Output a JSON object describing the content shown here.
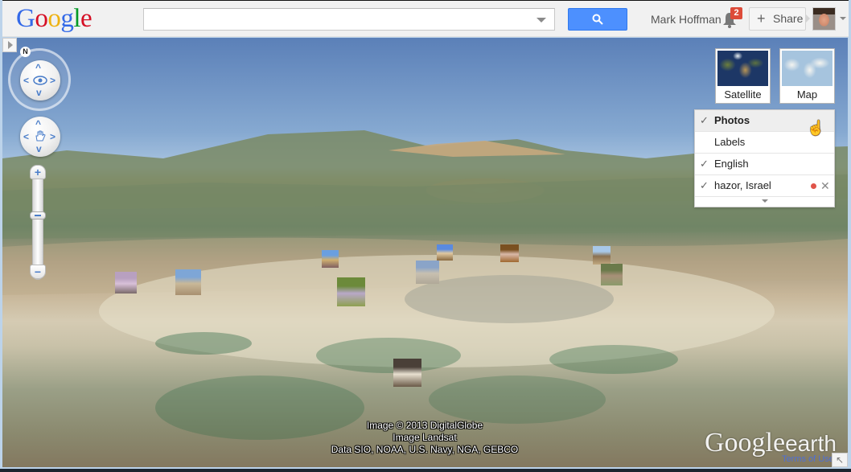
{
  "header": {
    "logo_letters": [
      "G",
      "o",
      "o",
      "g",
      "l",
      "e"
    ],
    "search": {
      "value": "",
      "placeholder": ""
    },
    "search_button_icon": "search-icon",
    "user_name": "Mark Hoffman",
    "notification_count": "2",
    "share_label": "Share",
    "share_icon": "+",
    "avatar_icon": "user-avatar"
  },
  "navigation": {
    "north_label": "N",
    "look_arrows": [
      "^",
      "<",
      ">",
      "v"
    ],
    "move_arrows": [
      "^",
      "<",
      ">",
      "v"
    ],
    "zoom_in": "+",
    "zoom_out": "−",
    "zoom_level": 0.4
  },
  "map_types": [
    {
      "label": "Satellite"
    },
    {
      "label": "Map"
    }
  ],
  "layers": [
    {
      "label": "Photos",
      "checked": true,
      "check": "✓",
      "bold": true,
      "hover": true
    },
    {
      "label": "Labels",
      "checked": false,
      "check": "",
      "bold": false
    },
    {
      "label": "English",
      "checked": true,
      "check": "✓",
      "bold": false
    },
    {
      "label": "hazor, Israel",
      "checked": true,
      "check": "✓",
      "bold": false,
      "dot_color": "#e0544a",
      "remove": "✕"
    }
  ],
  "photos": [
    {
      "colors": [
        "#b8a0c0",
        "#d8c0d8",
        "#7a6a6a"
      ]
    },
    {
      "colors": [
        "#7ea6d6",
        "#c9b898",
        "#a89070"
      ]
    },
    {
      "colors": [
        "#6a9fe0",
        "#d0b070",
        "#806060"
      ]
    },
    {
      "colors": [
        "#6c8a3a",
        "#b8a8c8",
        "#8ea050"
      ]
    },
    {
      "colors": [
        "#5a8ae0",
        "#e0c8a0",
        "#8a6a40"
      ]
    },
    {
      "colors": [
        "#8aa4c8",
        "#c8c0b0",
        "#b0a898"
      ]
    },
    {
      "colors": [
        "#7a5020",
        "#d8b8a8",
        "#a06830"
      ]
    },
    {
      "colors": [
        "#a8c8e8",
        "#8a7050",
        "#c0a880"
      ]
    },
    {
      "colors": [
        "#6a7a4a",
        "#a89078",
        "#8a9a6a"
      ]
    },
    {
      "colors": [
        "#4a4038",
        "#e8e0d0",
        "#6a5a48"
      ]
    }
  ],
  "attribution": {
    "line1": "Image © 2013 DigitalGlobe",
    "line2": "Image Landsat",
    "line3": "Data SIO, NOAA, U.S. Navy, NGA, GEBCO"
  },
  "branding": {
    "google": "Google",
    "earth": "earth"
  },
  "terms_label": "Terms of Use",
  "collapse_icon": "↖"
}
